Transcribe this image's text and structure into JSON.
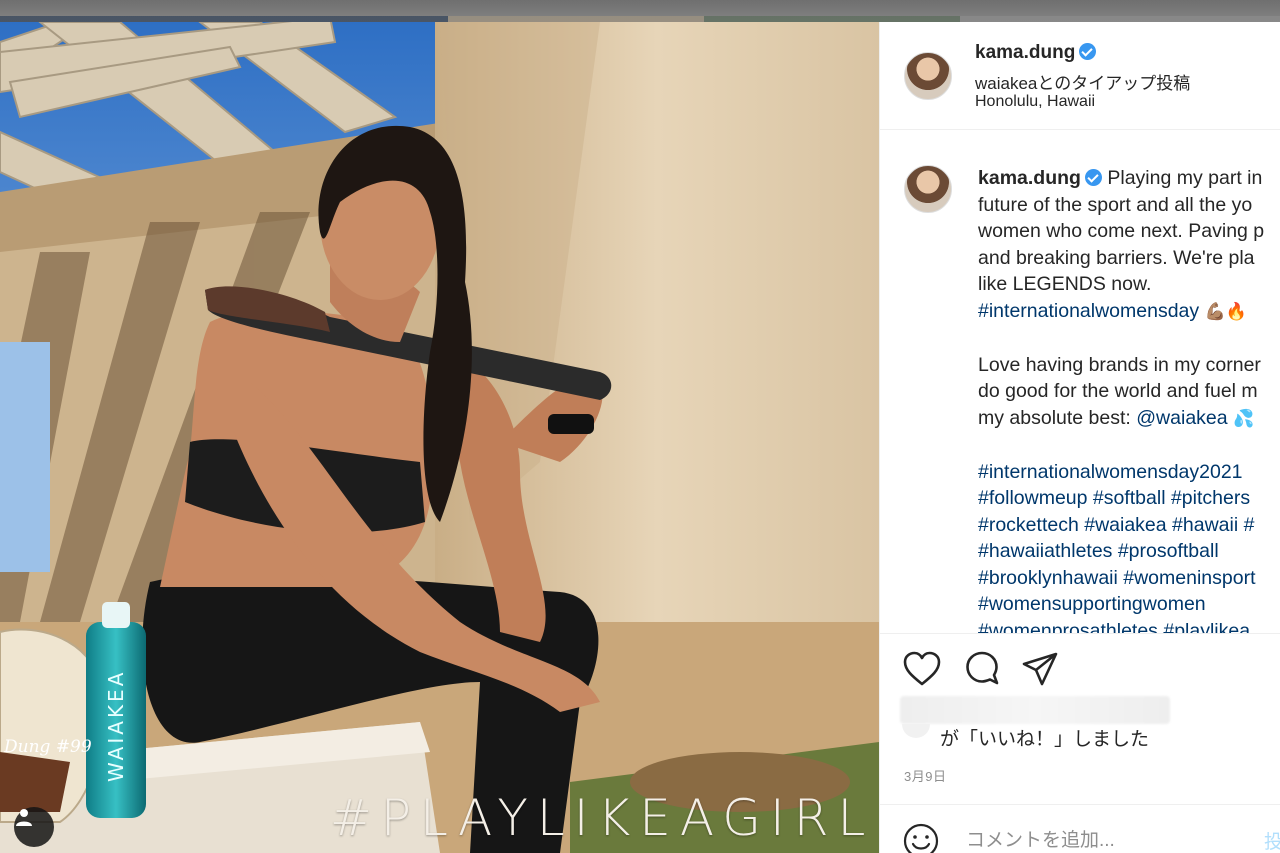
{
  "photo": {
    "overlay_text": "#PLAYLIKEAGIRL",
    "bottle_label": "WAIAKEA",
    "glove_text": "Dung #99"
  },
  "header": {
    "username": "kama.dung",
    "partnership_brand": "waiakea",
    "partnership_suffix": "とのタイアップ投稿",
    "location": "Honolulu, Hawaii"
  },
  "caption": {
    "username": "kama.dung",
    "line1": "Playing my part in",
    "line2": "future of the sport and all the yo",
    "line3": "women who come next. Paving p",
    "line4": "and breaking barriers. We're pla",
    "line5": "like LEGENDS now.",
    "tag1": "#internationalwomensday",
    "emoji1": "💪🏽🔥",
    "line6": "Love having brands in my corner",
    "line7": "do good for the world and fuel m",
    "line8": "my absolute best:",
    "mention": "@waiakea",
    "emoji2": "💦",
    "tags_row1": "#internationalwomensday2021",
    "tags_row2": "#followmeup #softball #pitchers",
    "tags_row3": "#rockettech #waiakea #hawaii #",
    "tags_row4": "#hawaiiathletes #prosoftball",
    "tags_row5": "#brooklynhawaii #womeninsport",
    "tags_row6": "#womensupportingwomen",
    "tags_row7": "#womenprosathletes #playlikea"
  },
  "actions": {
    "like_icon": "heart-icon",
    "comment_icon": "comment-icon",
    "share_icon": "paper-plane-icon",
    "likes_text": "が「いいね！」しました",
    "date": "3月9日"
  },
  "comment": {
    "placeholder": "コメントを追加...",
    "post_label": "投稿する"
  },
  "colors": {
    "hashtag": "#00376b",
    "verified": "#3897f0",
    "muted": "#8e8e8e"
  }
}
